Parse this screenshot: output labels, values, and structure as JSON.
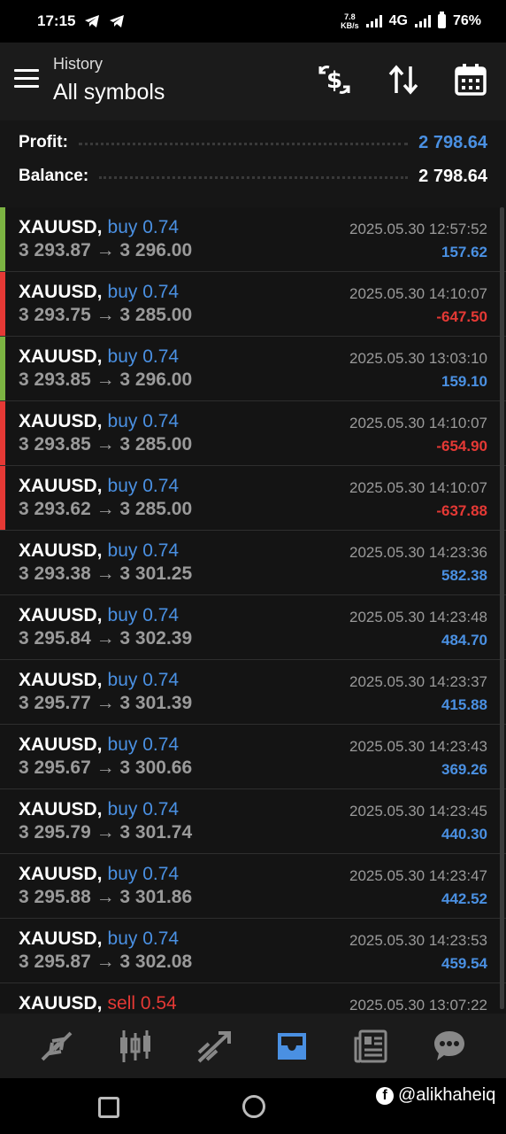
{
  "status": {
    "time": "17:15",
    "net_speed_value": "7.8",
    "net_speed_unit": "KB/s",
    "network": "4G",
    "battery": "76%"
  },
  "header": {
    "section": "History",
    "title": "All symbols"
  },
  "summary": {
    "profit_label": "Profit:",
    "profit_value": "2 798.64",
    "balance_label": "Balance:",
    "balance_value": "2 798.64"
  },
  "colors": {
    "accent_blue": "#4a90e2",
    "loss_red": "#e53935",
    "gain_green": "#7cb342"
  },
  "deals": [
    {
      "symbol": "XAUUSD,",
      "side": "buy 0.74",
      "side_type": "buy",
      "prices": "3 293.87 → 3 296.00",
      "time": "2025.05.30 12:57:52",
      "profit": "157.62",
      "profit_type": "pos",
      "marker": "green"
    },
    {
      "symbol": "XAUUSD,",
      "side": "buy 0.74",
      "side_type": "buy",
      "prices": "3 293.75 → 3 285.00",
      "time": "2025.05.30 14:10:07",
      "profit": "-647.50",
      "profit_type": "neg",
      "marker": "red"
    },
    {
      "symbol": "XAUUSD,",
      "side": "buy 0.74",
      "side_type": "buy",
      "prices": "3 293.85 → 3 296.00",
      "time": "2025.05.30 13:03:10",
      "profit": "159.10",
      "profit_type": "pos",
      "marker": "green"
    },
    {
      "symbol": "XAUUSD,",
      "side": "buy 0.74",
      "side_type": "buy",
      "prices": "3 293.85 → 3 285.00",
      "time": "2025.05.30 14:10:07",
      "profit": "-654.90",
      "profit_type": "neg",
      "marker": "red"
    },
    {
      "symbol": "XAUUSD,",
      "side": "buy 0.74",
      "side_type": "buy",
      "prices": "3 293.62 → 3 285.00",
      "time": "2025.05.30 14:10:07",
      "profit": "-637.88",
      "profit_type": "neg",
      "marker": "red"
    },
    {
      "symbol": "XAUUSD,",
      "side": "buy 0.74",
      "side_type": "buy",
      "prices": "3 293.38 → 3 301.25",
      "time": "2025.05.30 14:23:36",
      "profit": "582.38",
      "profit_type": "pos",
      "marker": "none"
    },
    {
      "symbol": "XAUUSD,",
      "side": "buy 0.74",
      "side_type": "buy",
      "prices": "3 295.84 → 3 302.39",
      "time": "2025.05.30 14:23:48",
      "profit": "484.70",
      "profit_type": "pos",
      "marker": "none"
    },
    {
      "symbol": "XAUUSD,",
      "side": "buy 0.74",
      "side_type": "buy",
      "prices": "3 295.77 → 3 301.39",
      "time": "2025.05.30 14:23:37",
      "profit": "415.88",
      "profit_type": "pos",
      "marker": "none"
    },
    {
      "symbol": "XAUUSD,",
      "side": "buy 0.74",
      "side_type": "buy",
      "prices": "3 295.67 → 3 300.66",
      "time": "2025.05.30 14:23:43",
      "profit": "369.26",
      "profit_type": "pos",
      "marker": "none"
    },
    {
      "symbol": "XAUUSD,",
      "side": "buy 0.74",
      "side_type": "buy",
      "prices": "3 295.79 → 3 301.74",
      "time": "2025.05.30 14:23:45",
      "profit": "440.30",
      "profit_type": "pos",
      "marker": "none"
    },
    {
      "symbol": "XAUUSD,",
      "side": "buy 0.74",
      "side_type": "buy",
      "prices": "3 295.88 → 3 301.86",
      "time": "2025.05.30 14:23:47",
      "profit": "442.52",
      "profit_type": "pos",
      "marker": "none"
    },
    {
      "symbol": "XAUUSD,",
      "side": "buy 0.74",
      "side_type": "buy",
      "prices": "3 295.87 → 3 302.08",
      "time": "2025.05.30 14:23:53",
      "profit": "459.54",
      "profit_type": "pos",
      "marker": "none"
    },
    {
      "symbol": "XAUUSD,",
      "side": "sell 0.54",
      "side_type": "sell",
      "prices": "",
      "time": "2025.05.30 13:07:22",
      "profit": "",
      "profit_type": "pos",
      "marker": "none"
    }
  ],
  "nav": {
    "items": [
      "quotes-icon",
      "chart-icon",
      "trade-icon",
      "history-icon",
      "news-icon",
      "messages-icon"
    ],
    "active": "history-icon"
  },
  "watermark": {
    "handle": "@alikhaheiq"
  }
}
